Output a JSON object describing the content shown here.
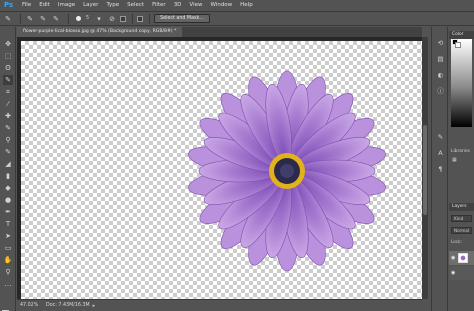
{
  "app": {
    "logo": "Ps",
    "accent": "#31a8ff"
  },
  "menu": [
    "File",
    "Edit",
    "Image",
    "Layer",
    "Type",
    "Select",
    "Filter",
    "3D",
    "View",
    "Window",
    "Help"
  ],
  "options": {
    "brush_size": "5",
    "button_label": "Select and Mask..."
  },
  "document": {
    "tab_title": "flower-purple-lical-blosso.jpg @ 47% (Background copy, RGB/8#) *",
    "zoom": "47.02%",
    "doc_info": "Doc: 7.43M/16.3M"
  },
  "panels": {
    "color_label": "Color",
    "libraries_label": "Libraries",
    "layers_label": "Layers",
    "layers_filter": "Kind",
    "blend_mode": "Normal",
    "lock_label": "Lock:"
  },
  "colors": {
    "foreground": "#000000",
    "background": "#ffffff",
    "petal": "#a67bd0",
    "center": "#2b2a4a"
  }
}
